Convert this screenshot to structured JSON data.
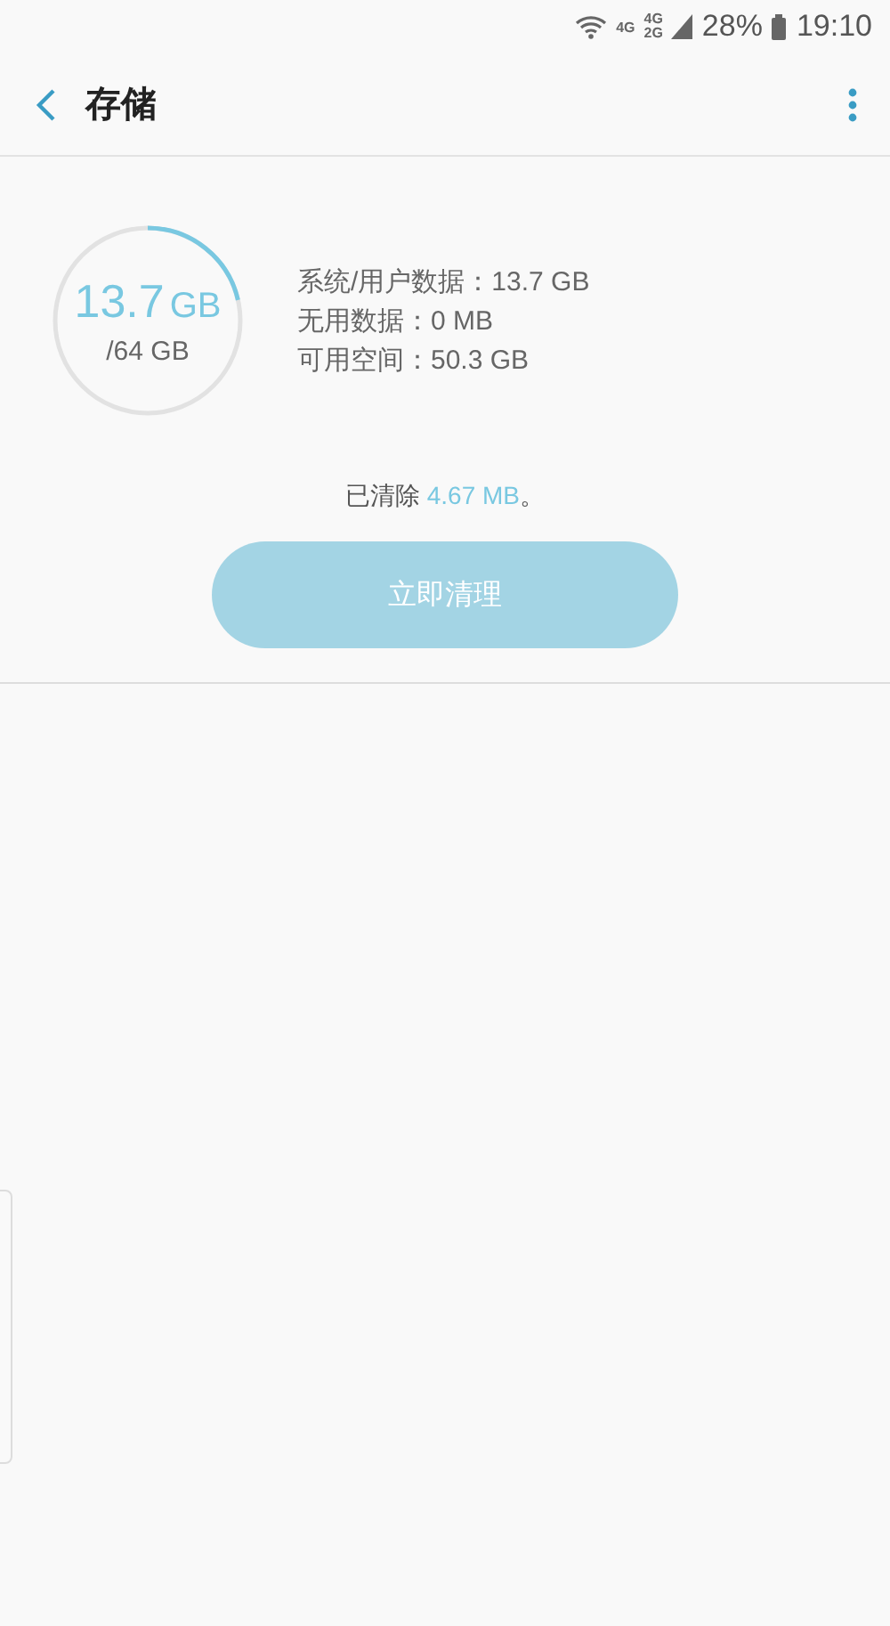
{
  "status_bar": {
    "network_1": "4G",
    "network_2_top": "4G",
    "network_2_bottom": "2G",
    "battery": "28%",
    "time": "19:10"
  },
  "header": {
    "title": "存储"
  },
  "storage": {
    "used": "13.7",
    "used_unit": "GB",
    "total": "/64 GB",
    "level": 0.214
  },
  "details": [
    "系统/用户数据：13.7 GB",
    "无用数据：0 MB",
    "可用空间：50.3 GB"
  ],
  "cleared": {
    "prefix": "已清除 ",
    "amount": "4.67 MB",
    "suffix": "。"
  },
  "clean_button": {
    "label": "立即清理",
    "disabled": true
  }
}
